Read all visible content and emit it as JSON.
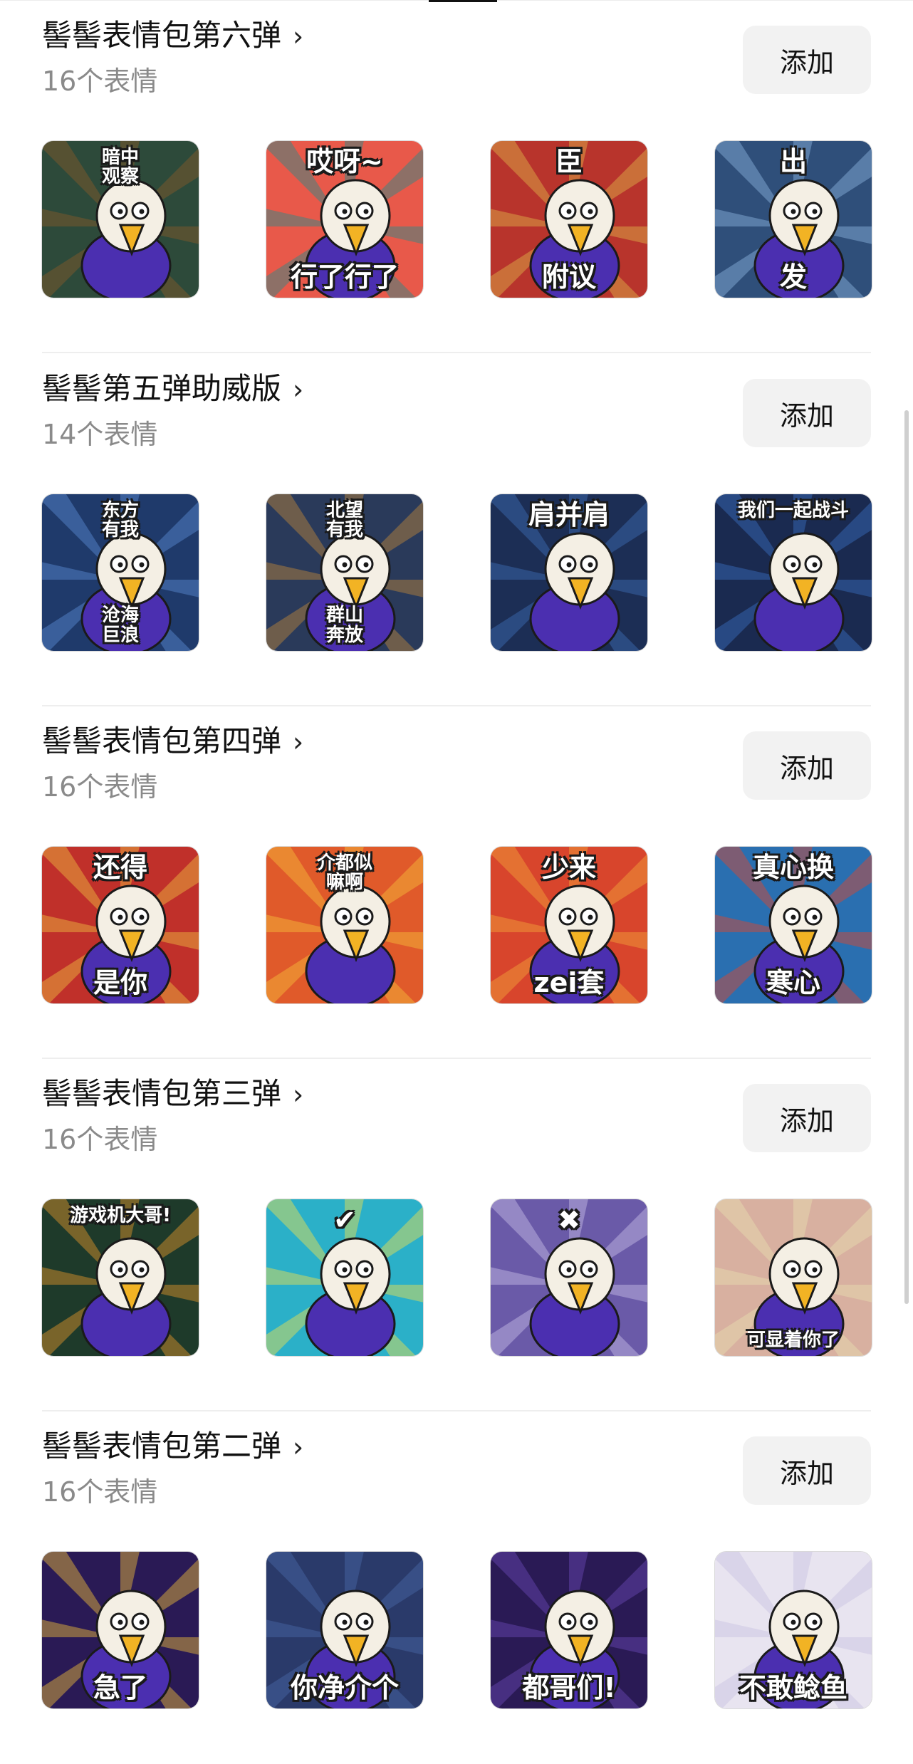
{
  "packs": [
    {
      "title": "髻髻表情包第六弹",
      "count": "16个表情",
      "add_label": "添加",
      "stickers": [
        {
          "caption_top": "暗中\n观察",
          "caption_bottom": "",
          "bg": "#2d4a3a",
          "accent": "#8a5a2b"
        },
        {
          "caption_top": "哎呀~",
          "caption_bottom": "行了行了",
          "bg": "#e8594a",
          "accent": "#1e8c8c"
        },
        {
          "caption_top": "臣",
          "caption_bottom": "附议",
          "bg": "#b8342c",
          "accent": "#e0b84a"
        },
        {
          "caption_top": "出",
          "caption_bottom": "发",
          "bg": "#2f4f7a",
          "accent": "#8fb6e0"
        }
      ]
    },
    {
      "title": "髻髻第五弹助威版",
      "count": "14个表情",
      "add_label": "添加",
      "stickers": [
        {
          "caption_top": "东方\n有我",
          "caption_bottom": "沧海\n巨浪",
          "bg": "#1f3a6b",
          "accent": "#5b8fd6"
        },
        {
          "caption_top": "北望\n有我",
          "caption_bottom": "群山\n奔放",
          "bg": "#2a3a5a",
          "accent": "#c08a3a"
        },
        {
          "caption_top": "肩并肩",
          "caption_bottom": "",
          "bg": "#1c2e55",
          "accent": "#3f6fb8"
        },
        {
          "caption_top": "我们一起战斗",
          "caption_bottom": "",
          "bg": "#1a2a50",
          "accent": "#3a6ec0"
        }
      ]
    },
    {
      "title": "髻髻表情包第四弹",
      "count": "16个表情",
      "add_label": "添加",
      "stickers": [
        {
          "caption_top": "还得",
          "caption_bottom": "是你",
          "bg": "#c0302a",
          "accent": "#f0c040"
        },
        {
          "caption_top": "介都似\n嘛啊",
          "caption_bottom": "",
          "bg": "#e05a2a",
          "accent": "#f7c23a"
        },
        {
          "caption_top": "少来",
          "caption_bottom": "zei套",
          "bg": "#d8452c",
          "accent": "#f4a63a"
        },
        {
          "caption_top": "真心换",
          "caption_bottom": "寒心",
          "bg": "#2a6fb0",
          "accent": "#e2452a"
        }
      ]
    },
    {
      "title": "髻髻表情包第三弹",
      "count": "16个表情",
      "add_label": "添加",
      "stickers": [
        {
          "caption_top": "游戏机大哥!",
          "caption_bottom": "",
          "bg": "#1e3a2a",
          "accent": "#e89a2a"
        },
        {
          "caption_top": "✔",
          "caption_bottom": "",
          "bg": "#2bb0c8",
          "accent": "#f4e24a"
        },
        {
          "caption_top": "✖",
          "caption_bottom": "",
          "bg": "#6a5aa8",
          "accent": "#c9c2e8"
        },
        {
          "caption_top": "",
          "caption_bottom": "可显着你了",
          "bg": "#d8b0a0",
          "accent": "#e8e0b0"
        }
      ]
    },
    {
      "title": "髻髻表情包第二弹",
      "count": "16个表情",
      "add_label": "添加",
      "stickers": [
        {
          "caption_top": "",
          "caption_bottom": "急了",
          "bg": "#2a1a55",
          "accent": "#f2c03a"
        },
        {
          "caption_top": "",
          "caption_bottom": "你净介个",
          "bg": "#2a3a6a",
          "accent": "#4a6aa8"
        },
        {
          "caption_top": "",
          "caption_bottom": "都哥们!",
          "bg": "#2a1a55",
          "accent": "#6a4ab8"
        },
        {
          "caption_top": "",
          "caption_bottom": "不敢鲶鱼",
          "bg": "#e8e4f0",
          "accent": "#c8c0e0"
        }
      ]
    }
  ]
}
